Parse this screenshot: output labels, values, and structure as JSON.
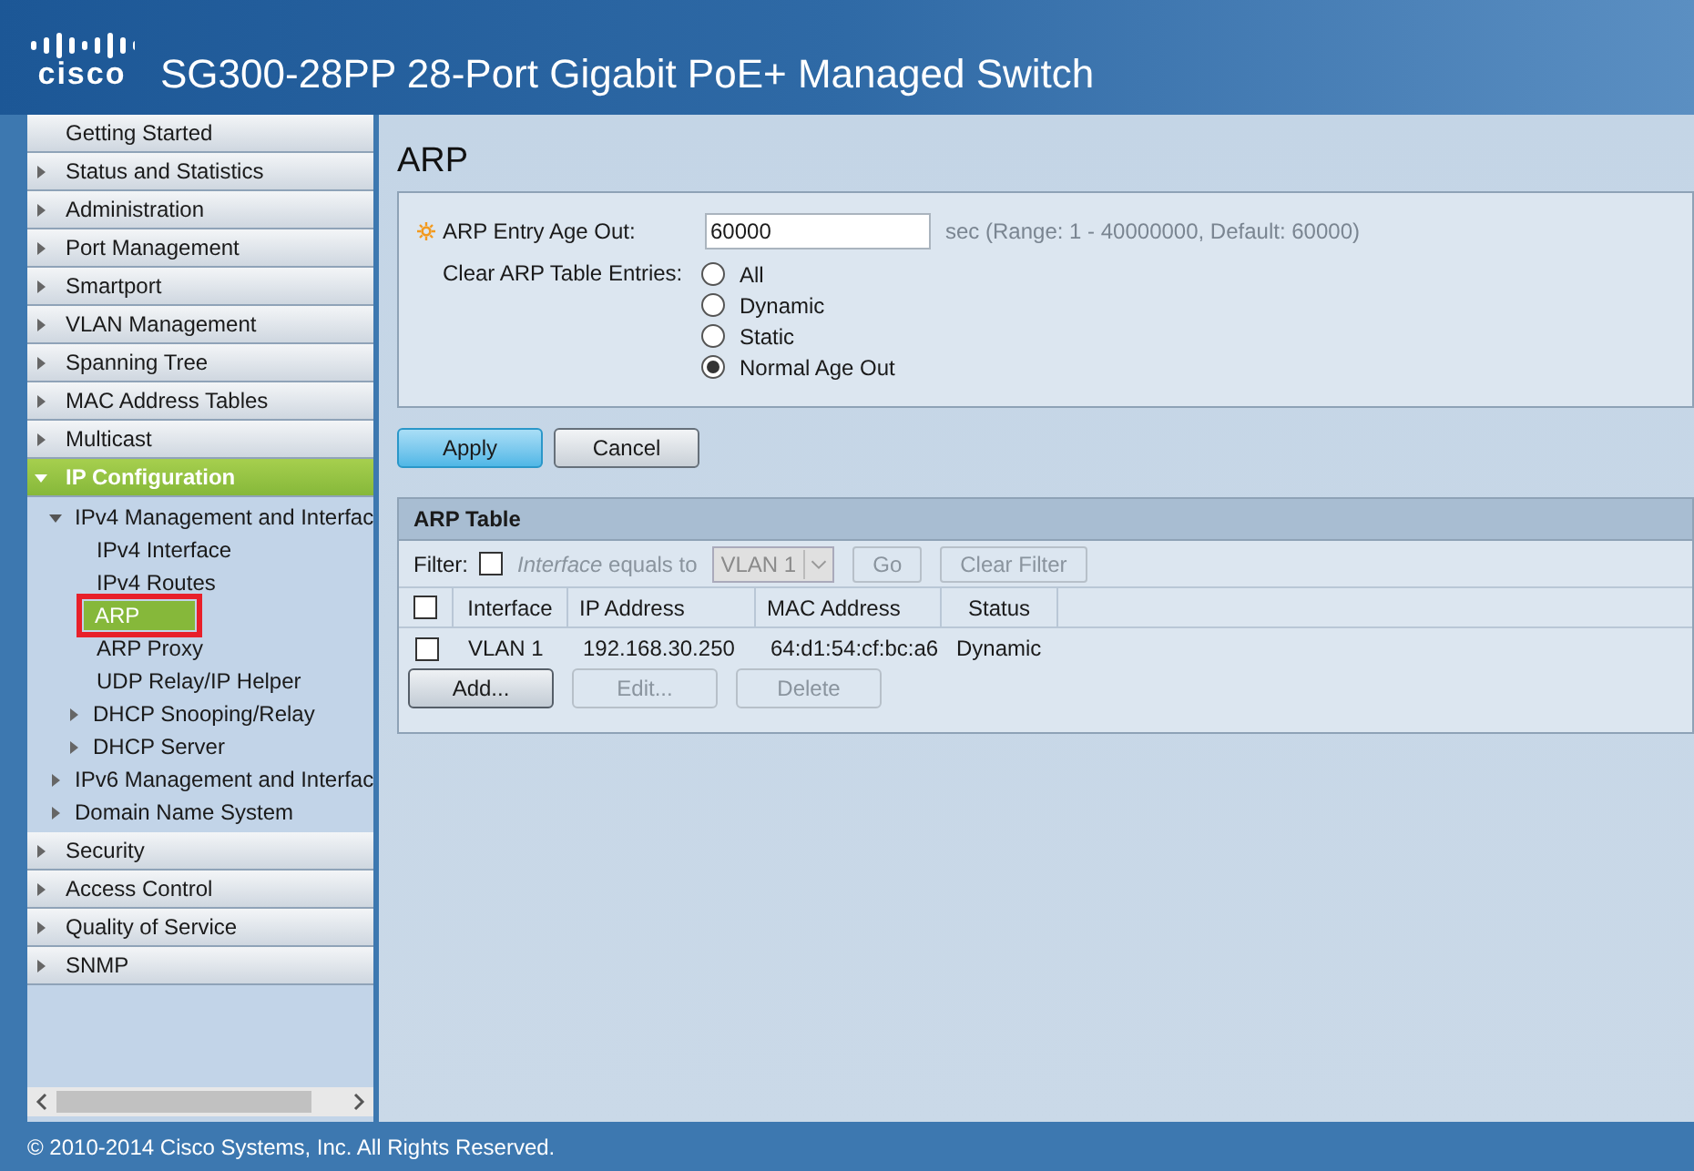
{
  "header": {
    "logo": "cisco",
    "title": "SG300-28PP 28-Port Gigabit PoE+ Managed Switch"
  },
  "sidebar": {
    "items": [
      {
        "label": "Getting Started",
        "kind": "page",
        "selected": false
      },
      {
        "label": "Status and Statistics",
        "kind": "folder",
        "expanded": false,
        "selected": false
      },
      {
        "label": "Administration",
        "kind": "folder",
        "expanded": false,
        "selected": false
      },
      {
        "label": "Port Management",
        "kind": "folder",
        "expanded": false,
        "selected": false
      },
      {
        "label": "Smartport",
        "kind": "folder",
        "expanded": false,
        "selected": false
      },
      {
        "label": "VLAN Management",
        "kind": "folder",
        "expanded": false,
        "selected": false
      },
      {
        "label": "Spanning Tree",
        "kind": "folder",
        "expanded": false,
        "selected": false
      },
      {
        "label": "MAC Address Tables",
        "kind": "folder",
        "expanded": false,
        "selected": false
      },
      {
        "label": "Multicast",
        "kind": "folder",
        "expanded": false,
        "selected": false
      },
      {
        "label": "IP Configuration",
        "kind": "folder",
        "expanded": true,
        "selected": true,
        "children": [
          {
            "label": "IPv4 Management and Interfac",
            "kind": "folder",
            "expanded": true,
            "selected": false,
            "children": [
              {
                "label": "IPv4 Interface",
                "kind": "page",
                "selected": false
              },
              {
                "label": "IPv4 Routes",
                "kind": "page",
                "selected": false
              },
              {
                "label": "ARP",
                "kind": "page",
                "selected": true,
                "outlined": true
              },
              {
                "label": "ARP Proxy",
                "kind": "page",
                "selected": false
              },
              {
                "label": "UDP Relay/IP Helper",
                "kind": "page",
                "selected": false
              },
              {
                "label": "DHCP Snooping/Relay",
                "kind": "folder",
                "expanded": false,
                "selected": false
              },
              {
                "label": "DHCP Server",
                "kind": "folder",
                "expanded": false,
                "selected": false
              }
            ]
          },
          {
            "label": "IPv6 Management and Interfac",
            "kind": "folder",
            "expanded": false,
            "selected": false
          },
          {
            "label": "Domain Name System",
            "kind": "folder",
            "expanded": false,
            "selected": false
          }
        ]
      },
      {
        "label": "Security",
        "kind": "folder",
        "expanded": false,
        "selected": false
      },
      {
        "label": "Access Control",
        "kind": "folder",
        "expanded": false,
        "selected": false
      },
      {
        "label": "Quality of Service",
        "kind": "folder",
        "expanded": false,
        "selected": false
      },
      {
        "label": "SNMP",
        "kind": "folder",
        "expanded": false,
        "selected": false
      }
    ]
  },
  "page_title": "ARP",
  "form": {
    "age_out": {
      "label": "ARP Entry Age Out:",
      "required": true,
      "value": "60000",
      "hint": "sec (Range: 1 - 40000000, Default: 60000)"
    },
    "clear": {
      "label": "Clear ARP Table Entries:",
      "options": [
        {
          "label": "All",
          "selected": false
        },
        {
          "label": "Dynamic",
          "selected": false
        },
        {
          "label": "Static",
          "selected": false
        },
        {
          "label": "Normal Age Out",
          "selected": true
        }
      ]
    }
  },
  "form_buttons": [
    {
      "label": "Apply",
      "kind": "primary"
    },
    {
      "label": "Cancel",
      "kind": "secondary"
    }
  ],
  "arp_table": {
    "title": "ARP Table",
    "filter": {
      "label": "Filter:",
      "checked": false,
      "field": "Interface",
      "condition": "equals to",
      "value": "VLAN 1",
      "disabled": true,
      "buttons": [
        {
          "label": "Go",
          "disabled": true
        },
        {
          "label": "Clear Filter",
          "disabled": true
        }
      ]
    },
    "header_checked": false,
    "columns": [
      "Interface",
      "IP Address",
      "MAC Address",
      "Status"
    ],
    "rows": [
      {
        "checked": false,
        "cells": [
          "VLAN 1",
          "192.168.30.250",
          "64:d1:54:cf:bc:a6",
          "Dynamic"
        ]
      }
    ],
    "buttons": [
      {
        "label": "Add...",
        "disabled": false
      },
      {
        "label": "Edit...",
        "disabled": true
      },
      {
        "label": "Delete",
        "disabled": true
      }
    ]
  },
  "footer": "© 2010-2014 Cisco Systems, Inc. All Rights Reserved."
}
